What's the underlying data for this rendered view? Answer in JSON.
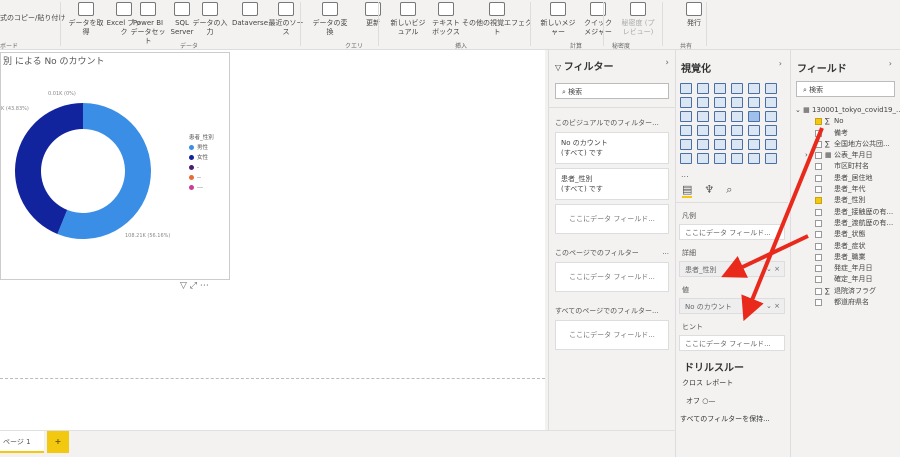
{
  "ribbon": {
    "clipboard": {
      "format_painter": "式のコピー/貼り付け",
      "group": "ボード"
    },
    "buttons": [
      "データを取得",
      "Excel ブック",
      "Power BI データセット",
      "SQL Server",
      "データの入力",
      "Dataverse",
      "最近のソース",
      "データの変換",
      "更新",
      "新しいビジュアル",
      "テキスト ボックス",
      "その他の視覚エフェクト",
      "新しいメジャー",
      "クイック メジャー",
      "秘密度 (プレビュー)",
      "発行"
    ],
    "groups": [
      "データ",
      "クエリ",
      "挿入",
      "計算",
      "秘密度",
      "共有"
    ]
  },
  "visual": {
    "title": "別 による No のカウント",
    "legend_title": "患者_性別",
    "menu": {
      "filter_icon": "filter-icon",
      "focus_icon": "focus-mode-icon",
      "more": "⋯"
    }
  },
  "chart_data": {
    "type": "pie",
    "donut": true,
    "categories": [
      "男性",
      "女性",
      "-",
      "--",
      "---"
    ],
    "values_k": [
      108.21,
      84.48,
      0.01,
      0,
      0
    ],
    "data_labels": [
      "108.21K (56.16%)",
      "K (43.83%)",
      "0.01K (0%)"
    ],
    "colors": [
      "#3a8ee6",
      "#12239e",
      "#4b1f6f",
      "#e66c37",
      "#c83d95"
    ],
    "legend_position": "right"
  },
  "filters": {
    "title": "フィルター",
    "search_placeholder": "検索",
    "visual_section": "このビジュアルでのフィルター...",
    "cards": [
      {
        "name": "No のカウント",
        "state": "(すべて) です"
      },
      {
        "name": "患者_性別",
        "state": "(すべて) です"
      }
    ],
    "drop": "ここにデータ フィールド...",
    "page_section": "このページでのフィルター",
    "page_more": "...",
    "all_section": "すべてのページでのフィルター..."
  },
  "viz": {
    "title": "視覚化",
    "more": "...",
    "wells": [
      {
        "label": "凡例",
        "value": "ここにデータ フィールド...",
        "filled": false
      },
      {
        "label": "詳細",
        "value": "患者_性別",
        "filled": true
      },
      {
        "label": "値",
        "value": "No のカウント",
        "filled": true
      },
      {
        "label": "ヒント",
        "value": "ここにデータ フィールド...",
        "filled": false
      }
    ],
    "drillthrough": "ドリルスルー",
    "cross_report": "クロス レポート",
    "toggle": "オフ",
    "keep_filters": "すべてのフィルターを保持..."
  },
  "fields": {
    "title": "フィールド",
    "search_placeholder": "検索",
    "table": "130001_tokyo_covid19_...",
    "items": [
      {
        "name": "No",
        "sigma": true,
        "checked": true
      },
      {
        "name": "備考"
      },
      {
        "name": "全国地方公共団...",
        "sigma": true
      },
      {
        "name": "公表_年月日",
        "date": true
      },
      {
        "name": "市区町村名"
      },
      {
        "name": "患者_居住地"
      },
      {
        "name": "患者_年代"
      },
      {
        "name": "患者_性別",
        "checked": true
      },
      {
        "name": "患者_接触歴の有..."
      },
      {
        "name": "患者_渡航歴の有..."
      },
      {
        "name": "患者_状態"
      },
      {
        "name": "患者_症状"
      },
      {
        "name": "患者_職業"
      },
      {
        "name": "発症_年月日"
      },
      {
        "name": "確定_年月日"
      },
      {
        "name": "退院済フラグ",
        "sigma": true
      },
      {
        "name": "都道府県名"
      }
    ]
  },
  "pages": {
    "tab": "ページ 1",
    "add": "+"
  },
  "accent": "#f2c811",
  "arrow_color": "#e8291c"
}
